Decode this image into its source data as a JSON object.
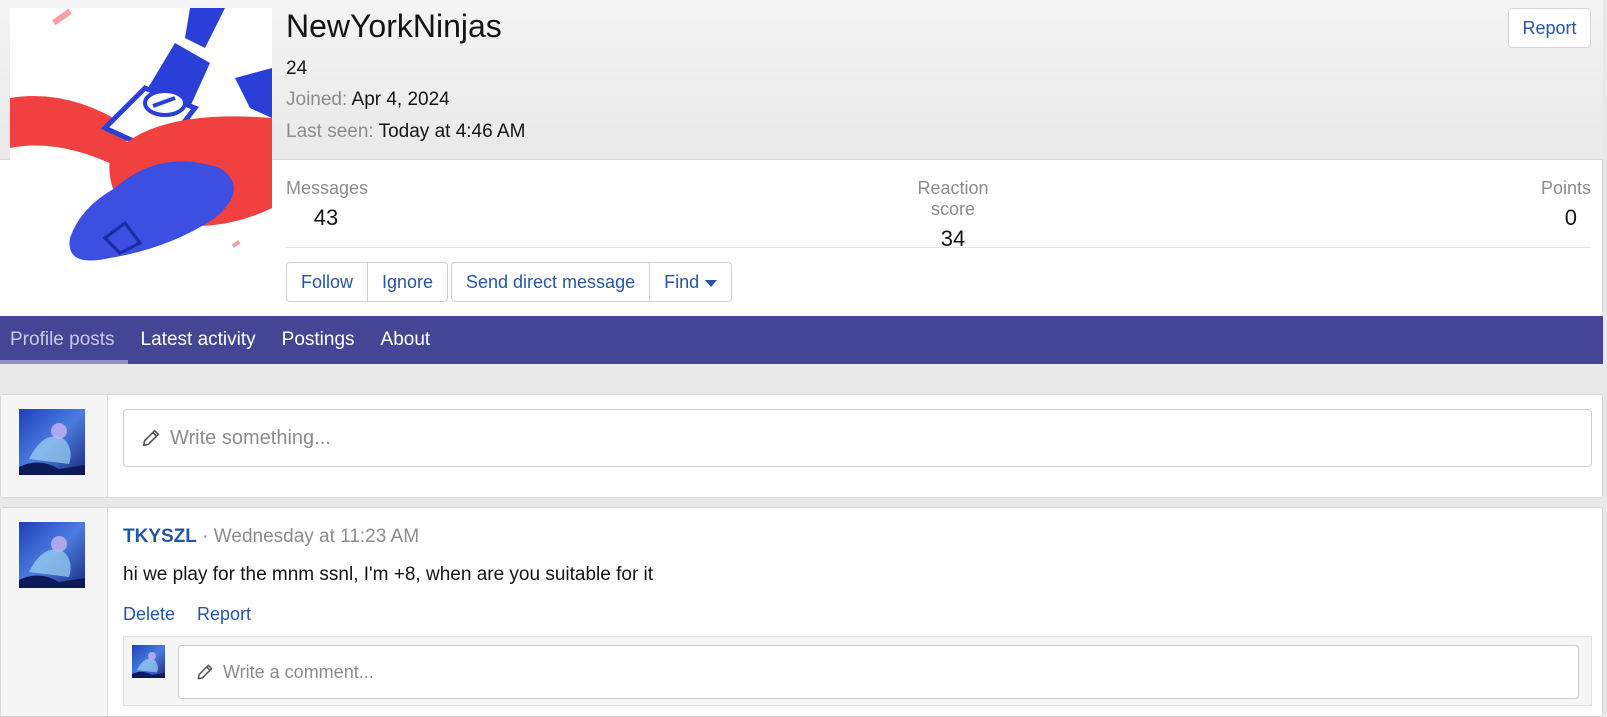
{
  "profile": {
    "username": "NewYorkNinjas",
    "title": "24",
    "joined_label": "Joined:",
    "joined_value": "Apr 4, 2024",
    "last_seen_label": "Last seen:",
    "last_seen_value": "Today at 4:46 AM",
    "report_label": "Report"
  },
  "stats": {
    "messages_label": "Messages",
    "messages_value": "43",
    "reaction_label": "Reaction score",
    "reaction_value": "34",
    "points_label": "Points",
    "points_value": "0"
  },
  "actions": {
    "follow": "Follow",
    "ignore": "Ignore",
    "send_dm": "Send direct message",
    "find": "Find"
  },
  "tabs": [
    {
      "label": "Profile posts",
      "active": true
    },
    {
      "label": "Latest activity",
      "active": false
    },
    {
      "label": "Postings",
      "active": false
    },
    {
      "label": "About",
      "active": false
    }
  ],
  "composer": {
    "placeholder": "Write something..."
  },
  "post": {
    "author": "TKYSZL",
    "separator": " · ",
    "time": "Wednesday at 11:23 AM",
    "body": "hi we play for the mnm ssnl, I'm +8, when are you suitable for it",
    "delete_label": "Delete",
    "report_label": "Report",
    "comment_placeholder": "Write a comment..."
  },
  "colors": {
    "accent": "#2456a6",
    "tab_bar": "#454596"
  }
}
